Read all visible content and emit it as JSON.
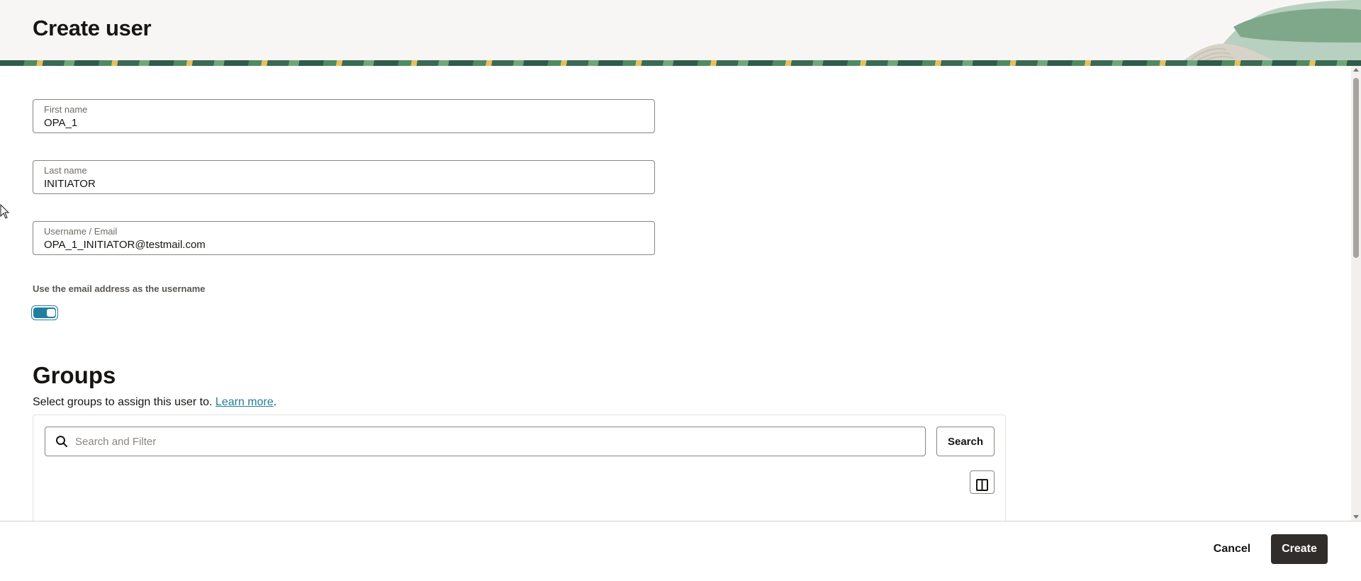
{
  "header": {
    "title": "Create user"
  },
  "form": {
    "first_name": {
      "label": "First name",
      "value": "OPA_1"
    },
    "last_name": {
      "label": "Last name",
      "value": "INITIATOR"
    },
    "username": {
      "label": "Username / Email",
      "value": "OPA_1_INITIATOR@testmail.com"
    },
    "use_email_toggle": {
      "label": "Use the email address as the username",
      "on": true
    }
  },
  "groups": {
    "title": "Groups",
    "description": "Select groups to assign this user to.",
    "learn_more": "Learn more",
    "punctuation": ".",
    "search_placeholder": "Search and Filter",
    "search_button": "Search",
    "columns_icon": "columns-icon"
  },
  "footer": {
    "cancel": "Cancel",
    "create": "Create"
  },
  "colors": {
    "accent": "#227e9e",
    "primary_button": "#312d2a",
    "header_bg": "#f8f6f4"
  }
}
